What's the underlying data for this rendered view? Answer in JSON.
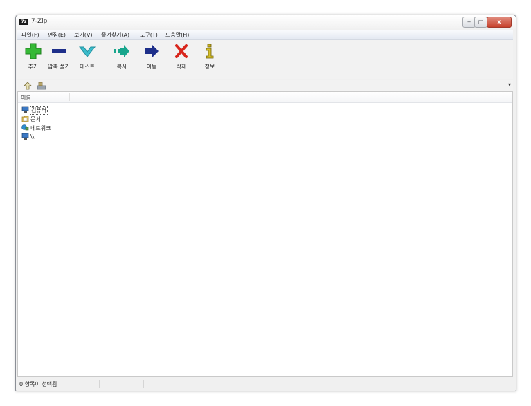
{
  "window": {
    "title": "7-Zip",
    "app_icon_text": "7z",
    "controls": {
      "minimize": "‒",
      "maximize": "▢",
      "close": "x"
    }
  },
  "menu": [
    {
      "label": "파일(F)"
    },
    {
      "label": "편집(E)"
    },
    {
      "label": "보기(V)"
    },
    {
      "label": "즐겨찾기(A)"
    },
    {
      "label": "도구(T)"
    },
    {
      "label": "도움말(H)"
    }
  ],
  "toolbar": [
    {
      "label": "추가",
      "icon": "add-icon",
      "color": "#2fb52f"
    },
    {
      "label": "압축 풀기",
      "icon": "extract-icon",
      "color": "#1e2f8a"
    },
    {
      "label": "테스트",
      "icon": "test-icon",
      "color": "#2aa8b8"
    },
    {
      "label": "복사",
      "icon": "copy-icon",
      "color": "#17a58c"
    },
    {
      "label": "이동",
      "icon": "move-icon",
      "color": "#1e2f8a"
    },
    {
      "label": "삭제",
      "icon": "delete-icon",
      "color": "#d8261c"
    },
    {
      "label": "정보",
      "icon": "info-icon",
      "color": "#b8a21a"
    }
  ],
  "address_bar": {
    "value": ""
  },
  "file_list": {
    "column_name": "이름",
    "items": [
      {
        "name": "컴퓨터",
        "icon": "computer-icon",
        "selected": true
      },
      {
        "name": "문서",
        "icon": "documents-folder-icon",
        "selected": false
      },
      {
        "name": "네트워크",
        "icon": "network-icon",
        "selected": false
      },
      {
        "name": "\\\\.",
        "icon": "device-icon",
        "selected": false
      }
    ]
  },
  "status_bar": {
    "text": "0 항목이 선택됨"
  }
}
